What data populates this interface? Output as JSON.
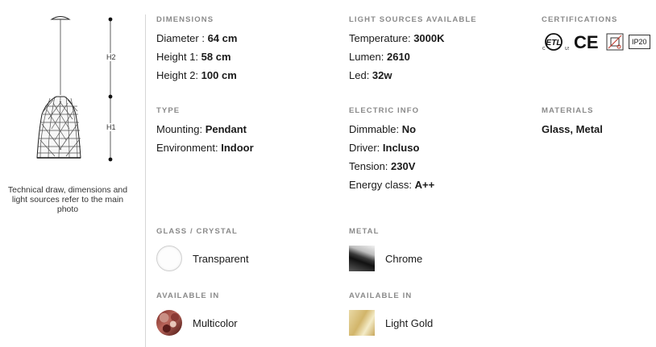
{
  "drawing": {
    "h2_label": "H2",
    "h1_label": "H1",
    "caption": "Technical draw, dimensions and light sources refer to the main photo"
  },
  "dimensions": {
    "heading": "DIMENSIONS",
    "rows": [
      {
        "label": "Diameter : ",
        "value": "64 cm"
      },
      {
        "label": "Height 1: ",
        "value": "58 cm"
      },
      {
        "label": "Height 2: ",
        "value": "100 cm"
      }
    ]
  },
  "light_sources": {
    "heading": "LIGHT SOURCES AVAILABLE",
    "rows": [
      {
        "label": "Temperature: ",
        "value": "3000K"
      },
      {
        "label": "Lumen: ",
        "value": "2610"
      },
      {
        "label": "Led: ",
        "value": "32w"
      }
    ]
  },
  "certifications": {
    "heading": "CERTIFICATIONS",
    "ip_rating": "IP20",
    "ce_mark": "CE",
    "etl_mark": "ETL"
  },
  "type": {
    "heading": "TYPE",
    "rows": [
      {
        "label": "Mounting: ",
        "value": "Pendant"
      },
      {
        "label": "Environment: ",
        "value": "Indoor"
      }
    ]
  },
  "electric_info": {
    "heading": "ELECTRIC INFO",
    "rows": [
      {
        "label": "Dimmable: ",
        "value": "No"
      },
      {
        "label": "Driver: ",
        "value": "Incluso"
      },
      {
        "label": "Tension: ",
        "value": "230V"
      },
      {
        "label": "Energy class: ",
        "value": "A++"
      }
    ]
  },
  "materials": {
    "heading": "MATERIALS",
    "value": "Glass, Metal"
  },
  "glass_crystal": {
    "heading": "GLASS / CRYSTAL",
    "option": "Transparent"
  },
  "metal": {
    "heading": "METAL",
    "option": "Chrome"
  },
  "available_glass": {
    "heading": "AVAILABLE IN",
    "option": "Multicolor"
  },
  "available_metal": {
    "heading": "AVAILABLE IN",
    "option": "Light Gold"
  }
}
